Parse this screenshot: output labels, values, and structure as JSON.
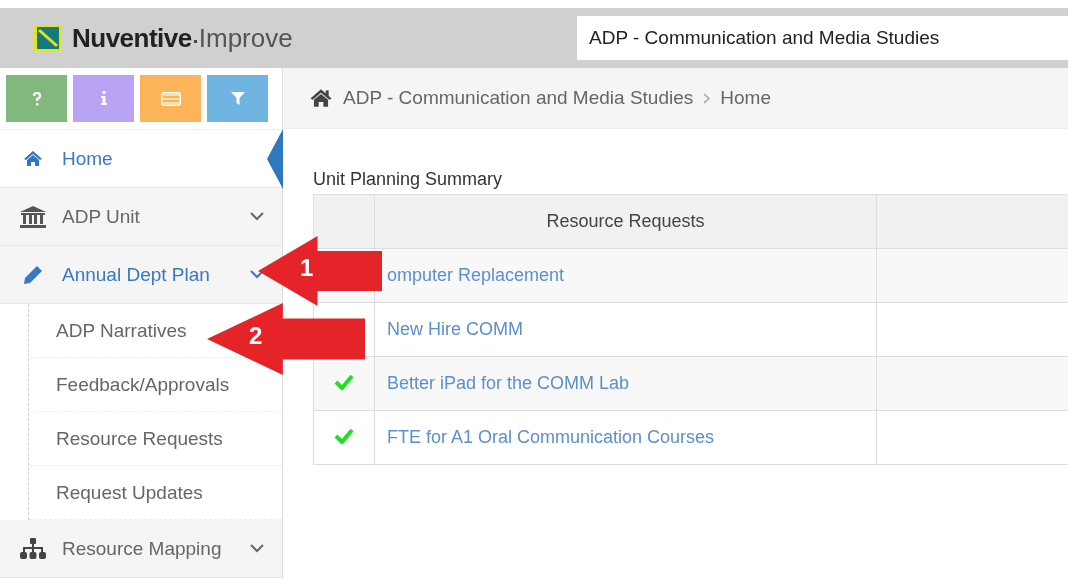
{
  "header": {
    "logo_brand": "Nuventive",
    "logo_product": "Improve",
    "unit_selector": "ADP - Communication and Media Studies"
  },
  "toolbar": [
    {
      "kind": "help",
      "color": "#82b87e"
    },
    {
      "kind": "info",
      "color": "#b9a3f5"
    },
    {
      "kind": "card",
      "color": "#fbb458"
    },
    {
      "kind": "filter",
      "color": "#70b4e2"
    }
  ],
  "breadcrumb": [
    "ADP - Communication and Media Studies",
    "Home"
  ],
  "sidebar": {
    "items": [
      {
        "label": "Home",
        "selected": true,
        "expanded": false,
        "has_children": false
      },
      {
        "label": "ADP Unit",
        "selected": false,
        "expanded": false,
        "has_children": true
      },
      {
        "label": "Annual Dept Plan",
        "selected": false,
        "expanded": true,
        "has_children": true,
        "children": [
          {
            "label": "ADP Narratives"
          },
          {
            "label": "Feedback/Approvals"
          },
          {
            "label": "Resource Requests"
          },
          {
            "label": "Request Updates"
          }
        ]
      },
      {
        "label": "Resource Mapping",
        "selected": false,
        "expanded": false,
        "has_children": true
      }
    ]
  },
  "summary": {
    "title": "Unit Planning Summary",
    "columns": [
      "Resource Requests"
    ],
    "rows": [
      {
        "request": "omputer Replacement"
      },
      {
        "request": "New Hire COMM"
      },
      {
        "checked": true,
        "request": "Better iPad for the COMM Lab"
      },
      {
        "checked": true,
        "request": "FTE for A1 Oral Communication Courses"
      }
    ]
  },
  "callouts": [
    {
      "number": "1"
    },
    {
      "number": "2"
    }
  ]
}
